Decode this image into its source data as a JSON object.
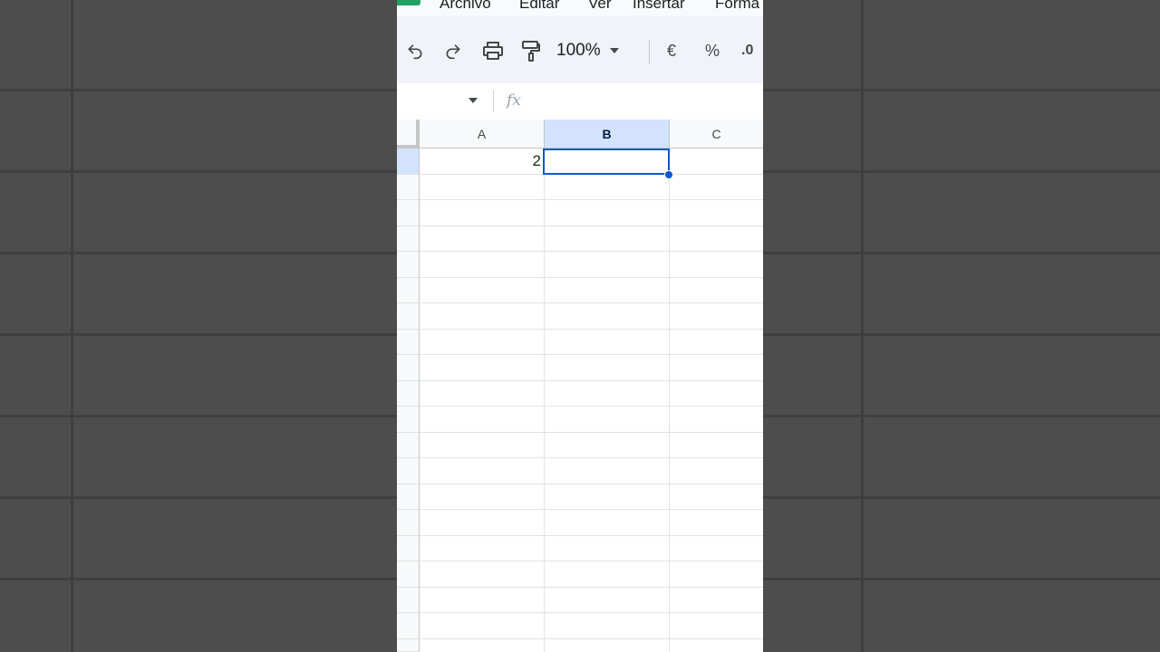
{
  "menu": {
    "items": [
      "Archivo",
      "Editar",
      "Ver",
      "Insertar",
      "Forma"
    ]
  },
  "toolbar": {
    "zoom_value": "100%",
    "currency_label": "€",
    "percent_label": "%",
    "decimal_label": ".0"
  },
  "formula_bar": {
    "fx_label": "fx",
    "formula_value": ""
  },
  "sheet": {
    "columns": [
      "A",
      "B",
      "C"
    ],
    "selected_column": "B",
    "cells": {
      "A1": "2",
      "B1": ""
    },
    "active_cell": "B1"
  },
  "colors": {
    "accent": "#0b57d0",
    "selected_header": "#d3e3fd",
    "app_green": "#1ea362"
  }
}
